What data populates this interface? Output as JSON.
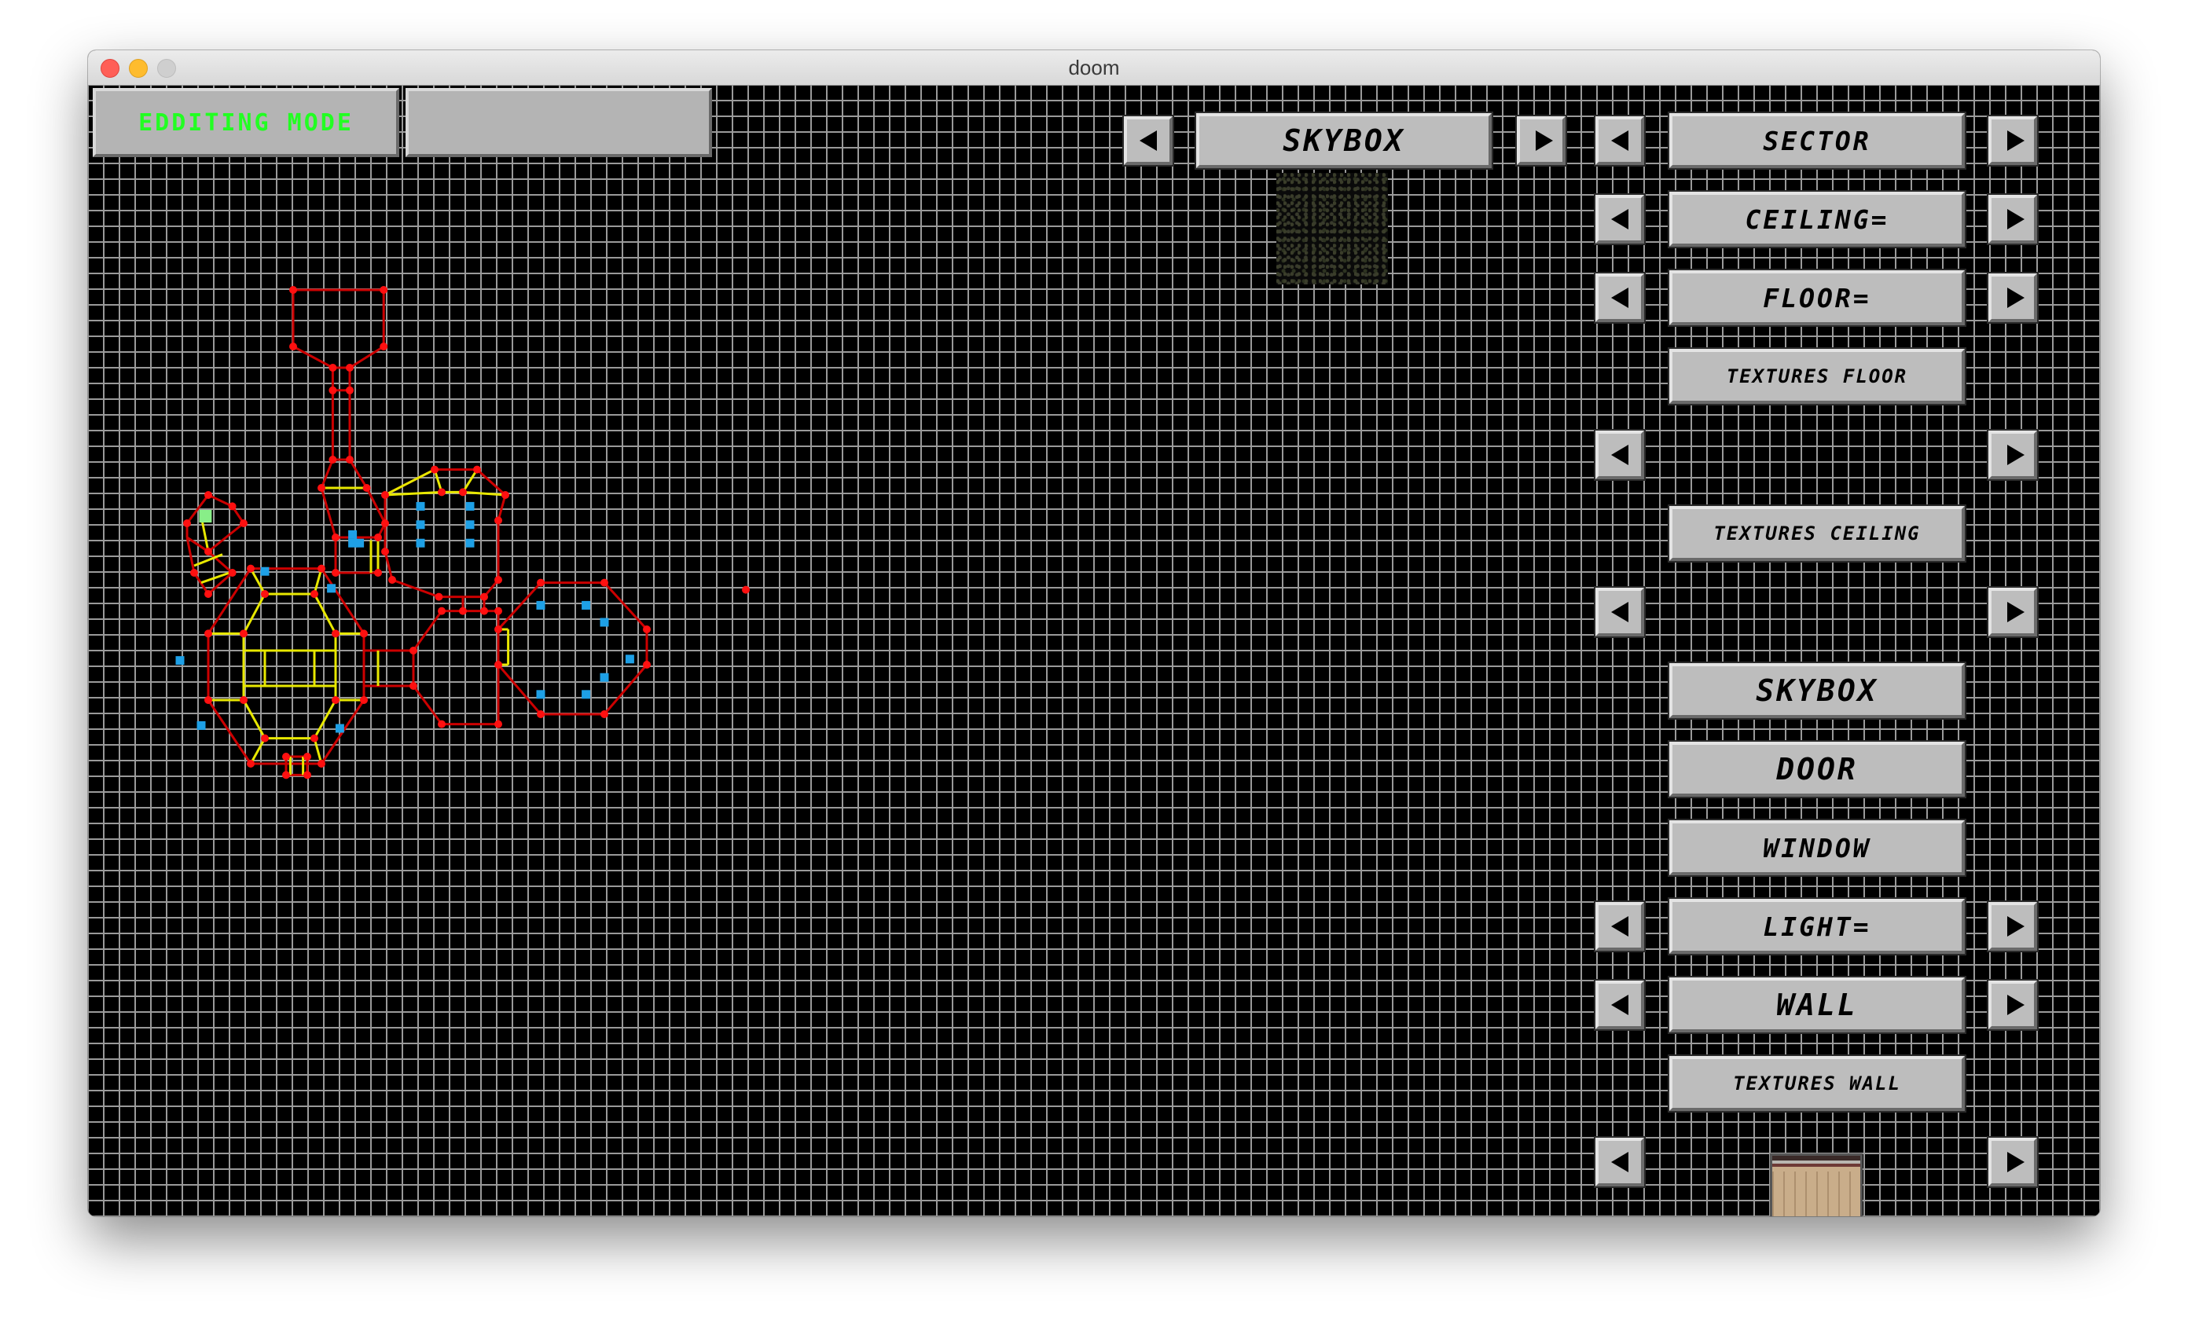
{
  "window": {
    "title": "doom"
  },
  "status": {
    "mode_label": "EDDITING MODE",
    "secondary_label": ""
  },
  "top_bar": {
    "skybox_label": "SKYBOX"
  },
  "right_panel": {
    "sector_label": "SECTOR",
    "ceiling_label": "CEILING=",
    "floor_label": "FLOOR=",
    "textures_floor_label": "TEXTURES FLOOR",
    "textures_ceiling_label": "TEXTURES CEILING",
    "skybox_label": "SKYBOX",
    "door_label": "DOOR",
    "window_label": "WINDOW",
    "light_label": "LIGHT=",
    "wall_label": "WALL",
    "textures_wall_label": "TEXTURES WALL"
  },
  "colors": {
    "grid_line": "#9a9a9a",
    "wall_line": "#cc0000",
    "portal_line": "#e8e800",
    "vertex": "#ff1010",
    "object_marker": "#1ea0e6",
    "player_marker": "#88ee88",
    "mode_text": "#22ff22",
    "button_face": "#bdbdbd"
  },
  "icons": {
    "arrow_left": "left-arrow-icon",
    "arrow_right": "right-arrow-icon"
  }
}
